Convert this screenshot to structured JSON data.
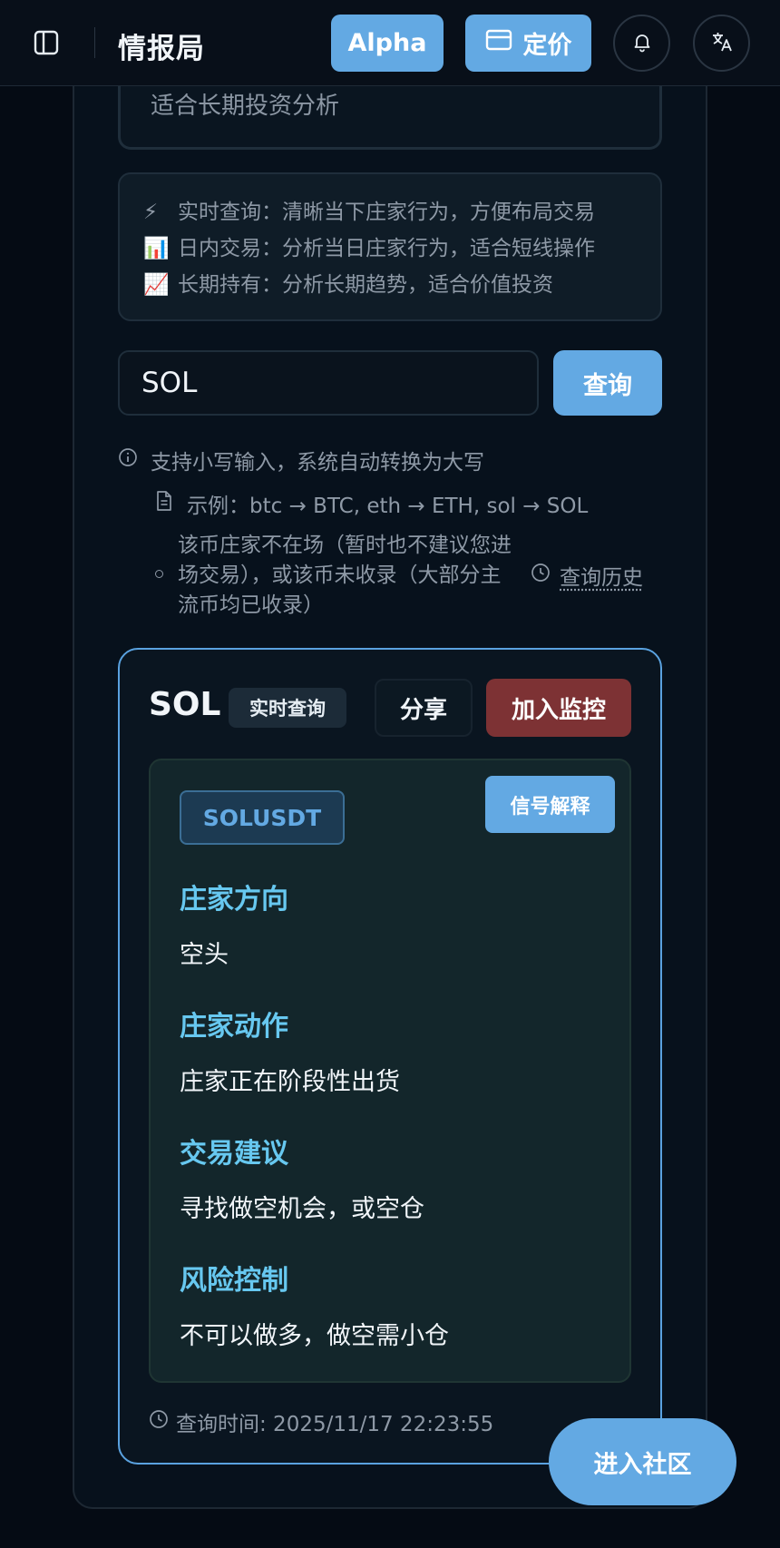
{
  "header": {
    "title": "情报局",
    "alpha_label": "Alpha",
    "pricing_label": "定价"
  },
  "previous_card": {
    "text": "适合长期投资分析"
  },
  "info_box": {
    "items": [
      {
        "emoji": "⚡",
        "text": "实时查询：清晰当下庄家行为，方便布局交易"
      },
      {
        "emoji": "📊",
        "text": "日内交易：分析当日庄家行为，适合短线操作"
      },
      {
        "emoji": "📈",
        "text": "长期持有：分析长期趋势，适合价值投资"
      }
    ]
  },
  "search": {
    "value": "SOL",
    "button_label": "查询"
  },
  "hints": {
    "lowercase": "支持小写输入，系统自动转换为大写",
    "example": "示例：btc → BTC, eth → ETH, sol → SOL",
    "not_present": "该币庄家不在场（暂时也不建议您进场交易），或该币未收录（大部分主流币均已收录）",
    "history_link": "查询历史"
  },
  "result": {
    "symbol": "SOL",
    "mode_badge": "实时查询",
    "share_label": "分享",
    "monitor_label": "加入监控",
    "pair": "SOLUSDT",
    "explain_label": "信号解释",
    "sections": [
      {
        "label": "庄家方向",
        "value": "空头"
      },
      {
        "label": "庄家动作",
        "value": "庄家正在阶段性出货"
      },
      {
        "label": "交易建议",
        "value": "寻找做空机会，或空仓"
      },
      {
        "label": "风险控制",
        "value": "不可以做多，做空需小仓"
      }
    ],
    "query_time": "查询时间: 2025/11/17 22:23:55"
  },
  "community_label": "进入社区",
  "colors": {
    "accent": "#63a9e3",
    "danger": "#7d3234",
    "label_cyan": "#67c8f0",
    "background": "#050b14"
  }
}
